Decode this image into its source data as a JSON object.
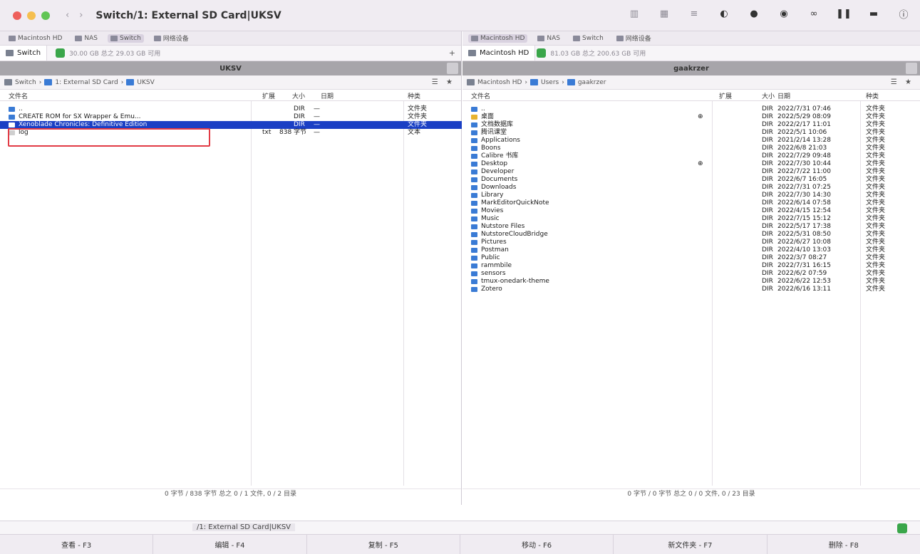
{
  "window": {
    "title": "Switch/1: External SD Card|UKSV",
    "nav_prev": "‹",
    "nav_next": "›"
  },
  "toolbar_icons": [
    "columns-icon",
    "grid-icon",
    "list-icon",
    "toggle-icon",
    "dot-icon",
    "eye-icon",
    "binoculars-icon",
    "pause-icon",
    "server-icon",
    "info-icon"
  ],
  "left": {
    "favorites": [
      {
        "label": "Macintosh HD",
        "active": false
      },
      {
        "label": "NAS",
        "active": false
      },
      {
        "label": "Switch",
        "active": true
      },
      {
        "label": "网络设备",
        "active": false
      }
    ],
    "tab_label": "Switch",
    "disk_info": "30.00 GB 总之 29.03 GB 可用",
    "header_title": "UKSV",
    "path": [
      "Switch",
      "1: External SD Card",
      "UKSV"
    ],
    "path_right": "☰ ★",
    "columns": {
      "name": "文件名",
      "ext": "扩展",
      "size": "大小",
      "date": "日期",
      "kind": "种类"
    },
    "rows": [
      {
        "name": "..",
        "ext": "",
        "size": "DIR",
        "date": "—",
        "kind": "文件夹",
        "icon": "folder"
      },
      {
        "name": "CREATE ROM for SX Wrapper & Emu...",
        "ext": "",
        "size": "DIR",
        "date": "—",
        "kind": "文件夹",
        "icon": "folder"
      },
      {
        "name": "Xenoblade Chronicles: Definitive Edition",
        "ext": "",
        "size": "DIR",
        "date": "—",
        "kind": "文件夹",
        "icon": "folder",
        "selected": true
      },
      {
        "name": "log",
        "ext": "txt",
        "size": "838 字节",
        "date": "—",
        "kind": "文本",
        "icon": "file"
      }
    ],
    "status": "0 字节 / 838 字节 总之 0 / 1 文件, 0 / 2 目录"
  },
  "right": {
    "favorites": [
      {
        "label": "Macintosh HD",
        "active": true
      },
      {
        "label": "NAS",
        "active": false
      },
      {
        "label": "Switch",
        "active": false
      },
      {
        "label": "网络设备",
        "active": false
      }
    ],
    "tab_label": "Macintosh HD",
    "disk_info": "81.03 GB 总之 200.63 GB 可用",
    "header_title": "gaakrzer",
    "path": [
      "Macintosh HD",
      "Users",
      "gaakrzer"
    ],
    "path_right": "☰ ★",
    "columns": {
      "name": "文件名",
      "ext": "扩展",
      "size": "大小",
      "date": "日期",
      "kind": "种类"
    },
    "rows": [
      {
        "name": "..",
        "size": "DIR",
        "date": "2022/7/31 07:46",
        "kind": "文件夹",
        "icon": "folder",
        "mark": ""
      },
      {
        "name": "桌面",
        "size": "DIR",
        "date": "2022/5/29 08:09",
        "kind": "文件夹",
        "icon": "yellow",
        "mark": "⊕"
      },
      {
        "name": "文档数据库",
        "size": "DIR",
        "date": "2022/2/17 11:01",
        "kind": "文件夹",
        "icon": "folder",
        "mark": ""
      },
      {
        "name": "腾讯课堂",
        "size": "DIR",
        "date": "2022/5/1 10:06",
        "kind": "文件夹",
        "icon": "folder",
        "mark": ""
      },
      {
        "name": "Applications",
        "size": "DIR",
        "date": "2021/2/14 13:28",
        "kind": "文件夹",
        "icon": "folder",
        "mark": ""
      },
      {
        "name": "Boons",
        "size": "DIR",
        "date": "2022/6/8 21:03",
        "kind": "文件夹",
        "icon": "folder",
        "mark": ""
      },
      {
        "name": "Calibre 书库",
        "size": "DIR",
        "date": "2022/7/29 09:48",
        "kind": "文件夹",
        "icon": "folder",
        "mark": ""
      },
      {
        "name": "Desktop",
        "size": "DIR",
        "date": "2022/7/30 10:44",
        "kind": "文件夹",
        "icon": "folder",
        "mark": "⊕"
      },
      {
        "name": "Developer",
        "size": "DIR",
        "date": "2022/7/22 11:00",
        "kind": "文件夹",
        "icon": "folder",
        "mark": ""
      },
      {
        "name": "Documents",
        "size": "DIR",
        "date": "2022/6/7 16:05",
        "kind": "文件夹",
        "icon": "folder",
        "mark": ""
      },
      {
        "name": "Downloads",
        "size": "DIR",
        "date": "2022/7/31 07:25",
        "kind": "文件夹",
        "icon": "folder",
        "mark": ""
      },
      {
        "name": "Library",
        "size": "DIR",
        "date": "2022/7/30 14:30",
        "kind": "文件夹",
        "icon": "folder",
        "mark": ""
      },
      {
        "name": "MarkEditorQuickNote",
        "size": "DIR",
        "date": "2022/6/14 07:58",
        "kind": "文件夹",
        "icon": "folder",
        "mark": ""
      },
      {
        "name": "Movies",
        "size": "DIR",
        "date": "2022/4/15 12:54",
        "kind": "文件夹",
        "icon": "folder",
        "mark": ""
      },
      {
        "name": "Music",
        "size": "DIR",
        "date": "2022/7/15 15:12",
        "kind": "文件夹",
        "icon": "folder",
        "mark": ""
      },
      {
        "name": "Nutstore Files",
        "size": "DIR",
        "date": "2022/5/17 17:38",
        "kind": "文件夹",
        "icon": "folder",
        "mark": ""
      },
      {
        "name": "NutstoreCloudBridge",
        "size": "DIR",
        "date": "2022/5/31 08:50",
        "kind": "文件夹",
        "icon": "folder",
        "mark": ""
      },
      {
        "name": "Pictures",
        "size": "DIR",
        "date": "2022/6/27 10:08",
        "kind": "文件夹",
        "icon": "folder",
        "mark": ""
      },
      {
        "name": "Postman",
        "size": "DIR",
        "date": "2022/4/10 13:03",
        "kind": "文件夹",
        "icon": "folder",
        "mark": ""
      },
      {
        "name": "Public",
        "size": "DIR",
        "date": "2022/3/7 08:27",
        "kind": "文件夹",
        "icon": "folder",
        "mark": ""
      },
      {
        "name": "rammbile",
        "size": "DIR",
        "date": "2022/7/31 16:15",
        "kind": "文件夹",
        "icon": "folder",
        "mark": ""
      },
      {
        "name": "sensors",
        "size": "DIR",
        "date": "2022/6/2 07:59",
        "kind": "文件夹",
        "icon": "folder",
        "mark": ""
      },
      {
        "name": "tmux-onedark-theme",
        "size": "DIR",
        "date": "2022/6/22 12:53",
        "kind": "文件夹",
        "icon": "folder",
        "mark": ""
      },
      {
        "name": "Zotero",
        "size": "DIR",
        "date": "2022/6/16 13:11",
        "kind": "文件夹",
        "icon": "folder",
        "mark": ""
      }
    ],
    "status": "0 字节 / 0 字节 总之 0 / 0 文件, 0 / 23 目录"
  },
  "cmdline": {
    "path": "/1: External SD Card|UKSV"
  },
  "fkeys": [
    "查看 - F3",
    "编辑 - F4",
    "复制 - F5",
    "移动 - F6",
    "新文件夹 - F7",
    "删除 - F8"
  ],
  "colors": {
    "selection": "#1a3fc4",
    "highlight_box": "#e23b45",
    "folder": "#3a7bd5",
    "disk_green": "#3aa64a"
  }
}
